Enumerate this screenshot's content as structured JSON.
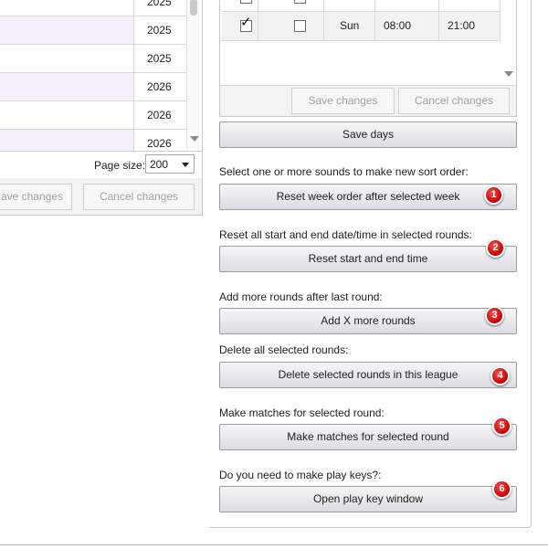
{
  "left_grid": {
    "rows": [
      {
        "year": "2025"
      },
      {
        "year": "2025"
      },
      {
        "year": "2025"
      },
      {
        "year": "2026"
      },
      {
        "year": "2026"
      },
      {
        "year": "2026"
      }
    ],
    "page_size_label": "Page size:",
    "page_size_value": "200",
    "save_changes_partial": "ave changes",
    "cancel_changes": "Cancel changes"
  },
  "days_grid": {
    "row": {
      "col1_checked": true,
      "col2_checked": false,
      "day": "Sun",
      "start": "08:00",
      "end": "21:00"
    },
    "save_changes": "Save changes",
    "cancel_changes": "Cancel changes"
  },
  "save_days": "Save days",
  "sections": [
    {
      "label": "Select one or more sounds to make new sort order:",
      "button": "Reset week order after selected week",
      "badge": "1"
    },
    {
      "label": "Reset all start and end date/time in selected rounds:",
      "button": "Reset start and end time",
      "badge": "2"
    },
    {
      "label": "Add more rounds after last round:",
      "button": "Add X more rounds",
      "badge": "3"
    },
    {
      "label": "Delete all selected rounds:",
      "button": "Delete selected rounds in this league",
      "badge": "4"
    },
    {
      "label": "Make matches for selected round:",
      "button": "Make matches for selected round",
      "badge": "5"
    },
    {
      "label": "Do you need to make play keys?:",
      "button": "Open play key window",
      "badge": "6"
    }
  ],
  "colors": {
    "badge_red": "#c80000",
    "alt_row": "#f3f0fb"
  }
}
